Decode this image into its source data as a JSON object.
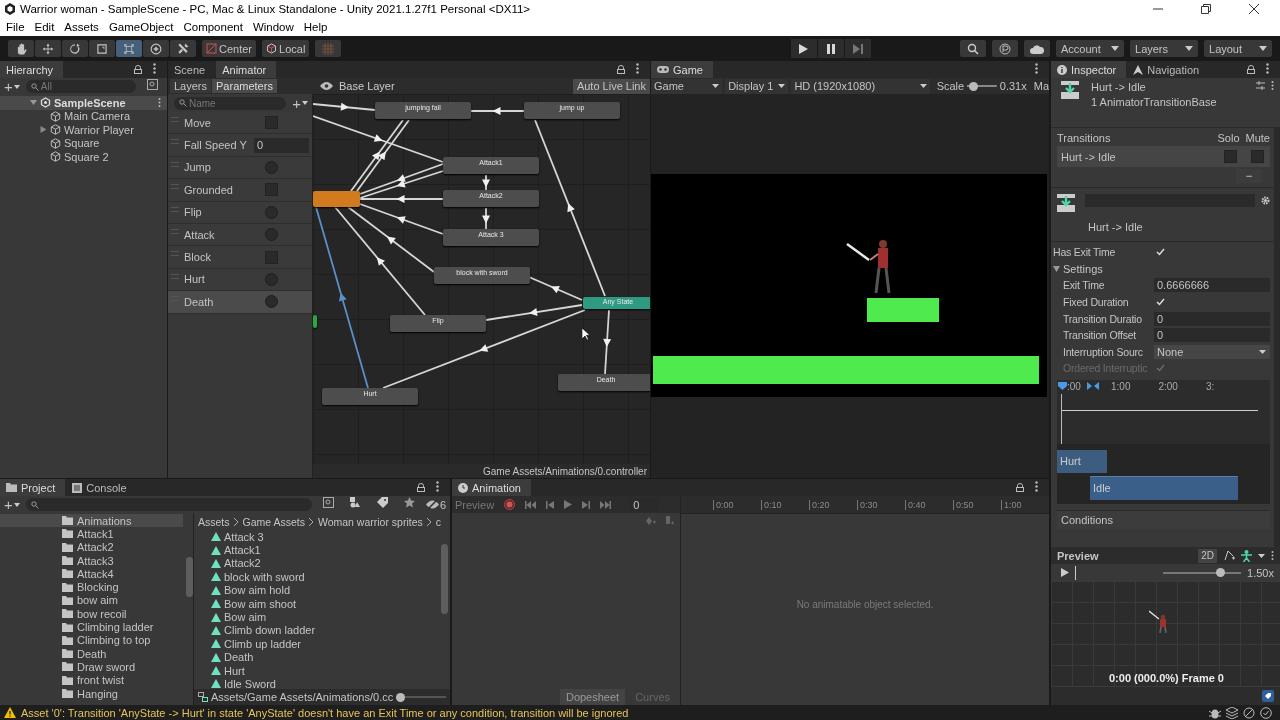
{
  "window": {
    "title": "Warrior woman - SampleScene - PC, Mac & Linux Standalone - Unity 2021.1.27f1 Personal <DX11>"
  },
  "menu": [
    "File",
    "Edit",
    "Assets",
    "GameObject",
    "Component",
    "Window",
    "Help"
  ],
  "toolbar": {
    "tools": [
      {
        "kind": "hand",
        "selected": false
      },
      {
        "kind": "move",
        "selected": false
      },
      {
        "kind": "rotate",
        "selected": false
      },
      {
        "kind": "scale",
        "selected": false
      },
      {
        "kind": "rect",
        "selected": true
      },
      {
        "kind": "transform",
        "selected": false
      },
      {
        "kind": "custom",
        "selected": false
      }
    ],
    "pivot": "Center",
    "space": "Local",
    "account": "Account",
    "layers": "Layers",
    "layout": "Layout"
  },
  "hierarchy": {
    "tab": "Hierarchy",
    "search_placeholder": "All",
    "scene": {
      "label": "SampleScene",
      "expanded": true,
      "children": [
        {
          "label": "Main Camera",
          "expandable": false
        },
        {
          "label": "Warrior Player",
          "expandable": true
        },
        {
          "label": "Square",
          "expandable": false
        },
        {
          "label": "Square 2",
          "expandable": false
        }
      ]
    },
    "add": "+"
  },
  "animator": {
    "tabs": [
      {
        "label": "Scene",
        "selected": false
      },
      {
        "label": "Animator",
        "selected": true
      }
    ],
    "subtabs": [
      {
        "label": "Layers",
        "selected": false
      },
      {
        "label": "Parameters",
        "selected": true
      }
    ],
    "layer": "Base Layer",
    "live_link": "Auto Live Link",
    "search_placeholder": "Name",
    "add": "+",
    "parameters": [
      {
        "name": "Move",
        "kind": "bool",
        "checked": false,
        "selected": false
      },
      {
        "name": "Fall Speed Y",
        "kind": "float",
        "value": "0",
        "selected": false
      },
      {
        "name": "Jump",
        "kind": "trigger",
        "checked": false,
        "selected": false
      },
      {
        "name": "Grounded",
        "kind": "bool",
        "checked": false,
        "selected": false
      },
      {
        "name": "Flip",
        "kind": "trigger",
        "checked": false,
        "selected": false
      },
      {
        "name": "Attack",
        "kind": "trigger",
        "checked": false,
        "selected": false
      },
      {
        "name": "Block",
        "kind": "bool",
        "checked": false,
        "selected": false
      },
      {
        "name": "Hurt",
        "kind": "trigger",
        "checked": false,
        "selected": false
      },
      {
        "name": "Death",
        "kind": "trigger",
        "checked": false,
        "selected": true
      }
    ],
    "states": [
      {
        "label": "jumping fall",
        "kind": "state"
      },
      {
        "label": "jump up",
        "kind": "state"
      },
      {
        "label": "Attack1",
        "kind": "state"
      },
      {
        "label": "Attack2",
        "kind": "state"
      },
      {
        "label": "Attack 3",
        "kind": "state"
      },
      {
        "label": "block with sword",
        "kind": "state"
      },
      {
        "label": "Any State",
        "kind": "any"
      },
      {
        "label": "Flip",
        "kind": "state"
      },
      {
        "label": "Hurt",
        "kind": "state"
      },
      {
        "label": "Death",
        "kind": "state"
      },
      {
        "kind": "default"
      },
      {
        "kind": "entry"
      }
    ],
    "path": "Game Assets/Animations/0.controller"
  },
  "game": {
    "tab": "Game",
    "view": "Game",
    "display": "Display 1",
    "resolution": "HD (1920x1080)",
    "scale_label": "Scale",
    "scale": {
      "level": 0.1
    },
    "scale_value": "0.31x",
    "maximize": "Ma"
  },
  "inspector": {
    "tabs": [
      {
        "label": "Inspector",
        "selected": true
      },
      {
        "label": "Navigation",
        "selected": false
      }
    ],
    "title": "Hurt -> Idle",
    "subtitle": "1 AnimatorTransitionBase",
    "transitions": {
      "header": "Transitions",
      "solo": "Solo",
      "mute": "Mute",
      "rows": [
        {
          "label": "Hurt -> Idle",
          "solo": false,
          "mute": false
        }
      ],
      "remove": "−"
    },
    "transition_name": "Hurt -> Idle",
    "has_exit_time": {
      "label": "Has Exit Time",
      "checked": true
    },
    "settings": {
      "label": "Settings",
      "expanded": true,
      "fields": [
        {
          "label": "Exit Time",
          "kind": "number",
          "value": "0.6666666",
          "disabled": false
        },
        {
          "label": "Fixed Duration",
          "kind": "checkbox",
          "checked": true,
          "disabled": false
        },
        {
          "label": "Transition Duratio",
          "kind": "number",
          "value": "0",
          "disabled": false
        },
        {
          "label": "Transition Offset",
          "kind": "number",
          "value": "0",
          "disabled": false
        },
        {
          "label": "Interruption Sourc",
          "kind": "dropdown",
          "value": "None",
          "disabled": false
        },
        {
          "label": "Ordered Interruptic",
          "kind": "checkbox",
          "checked": true,
          "disabled": true
        }
      ]
    },
    "timeline": {
      "ticks": [
        ":00",
        "1:00",
        "2:00",
        "3:"
      ],
      "clips": [
        {
          "label": "Hurt"
        },
        {
          "label": "Idle"
        }
      ]
    },
    "conditions": "Conditions",
    "preview": {
      "title": "Preview",
      "mode": "2D",
      "speed": {
        "level": 0.76
      },
      "speed_label": "1.50x",
      "frame": "0:00 (000.0%) Frame 0"
    }
  },
  "project": {
    "tabs": [
      {
        "label": "Project",
        "selected": true
      },
      {
        "label": "Console",
        "selected": false
      }
    ],
    "add": "+",
    "hidden_count": "6",
    "folders": [
      {
        "label": "Animations",
        "selected": true
      },
      {
        "label": "Attack1",
        "selected": false
      },
      {
        "label": "Attack2",
        "selected": false
      },
      {
        "label": "Attack3",
        "selected": false
      },
      {
        "label": "Attack4",
        "selected": false
      },
      {
        "label": "Blocking",
        "selected": false
      },
      {
        "label": "bow aim",
        "selected": false
      },
      {
        "label": "bow recoil",
        "selected": false
      },
      {
        "label": "Climbing ladder",
        "selected": false
      },
      {
        "label": "Climbing to top",
        "selected": false
      },
      {
        "label": "Death",
        "selected": false
      },
      {
        "label": "Draw sword",
        "selected": false
      },
      {
        "label": "front twist",
        "selected": false
      },
      {
        "label": "Hanging",
        "selected": false
      }
    ],
    "breadcrumb": [
      "Assets",
      "Game Assets",
      "Woman warrior sprites",
      "c"
    ],
    "files": [
      "Attack 3",
      "Attack1",
      "Attack2",
      "block with sword",
      "Bow aim hold",
      "Bow aim shoot",
      "Bow aim",
      "Climb down ladder",
      "Climb up ladder",
      "Death",
      "Hurt",
      "Idle Sword"
    ],
    "path": "Assets/Game Assets/Animations/0.cc",
    "zoom": {
      "level": 0.0
    }
  },
  "animation": {
    "tab": "Animation",
    "preview": "Preview",
    "frame": "0",
    "ticks": [
      "0:00",
      "0:10",
      "0:20",
      "0:30",
      "0:40",
      "0:50",
      "1:00"
    ],
    "message": "No animatable object selected.",
    "modes": [
      {
        "label": "Dopesheet",
        "selected": true
      },
      {
        "label": "Curves",
        "selected": false
      }
    ]
  },
  "status": "Asset '0': Transition 'AnyState -> Hurt' in state 'AnyState' doesn't have an Exit Time or any condition, transition will be ignored"
}
